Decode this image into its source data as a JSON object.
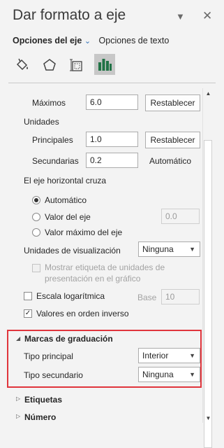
{
  "pane": {
    "title": "Dar formato a eje",
    "tabs": [
      "Opciones del eje",
      "Opciones de texto"
    ],
    "icons": [
      "fill-line-icon",
      "effects-icon",
      "size-properties-icon",
      "axis-options-icon"
    ]
  },
  "bounds": {
    "max_label": "Máximos",
    "max_value": "6.0",
    "max_reset": "Restablecer"
  },
  "units": {
    "label": "Unidades",
    "major_label": "Principales",
    "major_value": "1.0",
    "major_reset": "Restablecer",
    "minor_label": "Secundarias",
    "minor_value": "0.2",
    "minor_status": "Automático"
  },
  "crosses": {
    "label": "El eje horizontal cruza",
    "options": [
      "Automático",
      "Valor del eje",
      "Valor máximo del eje"
    ],
    "axis_value": "0.0"
  },
  "display_units": {
    "label": "Unidades de visualización",
    "value": "Ninguna",
    "show_label_line1": "Mostrar etiqueta de unidades de",
    "show_label_line2": "presentación en el gráfico"
  },
  "log_scale": {
    "label": "Escala logarítmica",
    "base_label": "Base",
    "base_value": "10"
  },
  "reverse": {
    "label": "Valores en orden inverso"
  },
  "tick_marks": {
    "header": "Marcas de graduación",
    "major_label": "Tipo principal",
    "major_value": "Interior",
    "minor_label": "Tipo secundario",
    "minor_value": "Ninguna"
  },
  "sections": [
    "Etiquetas",
    "Número"
  ],
  "colors": {
    "accent_green": "#217346",
    "highlight": "#e0353c"
  }
}
